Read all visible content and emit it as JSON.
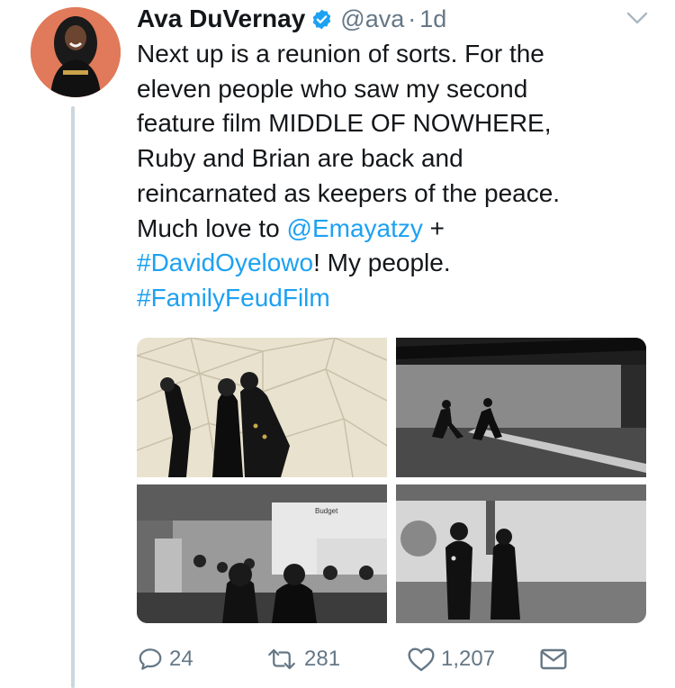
{
  "tweet": {
    "author_name": "Ava DuVernay",
    "handle": "@ava",
    "separator": "·",
    "time": "1d",
    "verified": true,
    "text_lines": [
      [
        {
          "t": "Next up is a reunion of sorts. For the",
          "link": false
        }
      ],
      [
        {
          "t": "eleven people who saw my second",
          "link": false
        }
      ],
      [
        {
          "t": "feature film MIDDLE OF NOWHERE,",
          "link": false
        }
      ],
      [
        {
          "t": "Ruby and Brian are back and",
          "link": false
        }
      ],
      [
        {
          "t": "reincarnated as keepers of the peace.",
          "link": false
        }
      ],
      [
        {
          "t": "Much love to ",
          "link": false
        },
        {
          "t": "@Emayatzy",
          "link": true
        },
        {
          "t": " +",
          "link": false
        }
      ],
      [
        {
          "t": "#DavidOyelowo",
          "link": true
        },
        {
          "t": "! My people.",
          "link": false
        }
      ],
      [
        {
          "t": "#FamilyFeudFilm",
          "link": true
        }
      ]
    ],
    "photo_truck_sign": "Budget"
  },
  "actions": {
    "reply_count": "24",
    "retweet_count": "281",
    "like_count": "1,207"
  },
  "colors": {
    "link": "#1da1f2",
    "secondary_text": "#657786",
    "verified_badge": "#1da1f2",
    "thread_line": "#ccd6dd",
    "avatar_bg": "#e07a5a"
  },
  "icons": {
    "verified": "verified-badge-icon",
    "caret": "chevron-down-icon",
    "reply": "reply-icon",
    "retweet": "retweet-icon",
    "like": "heart-icon",
    "message": "envelope-icon"
  }
}
